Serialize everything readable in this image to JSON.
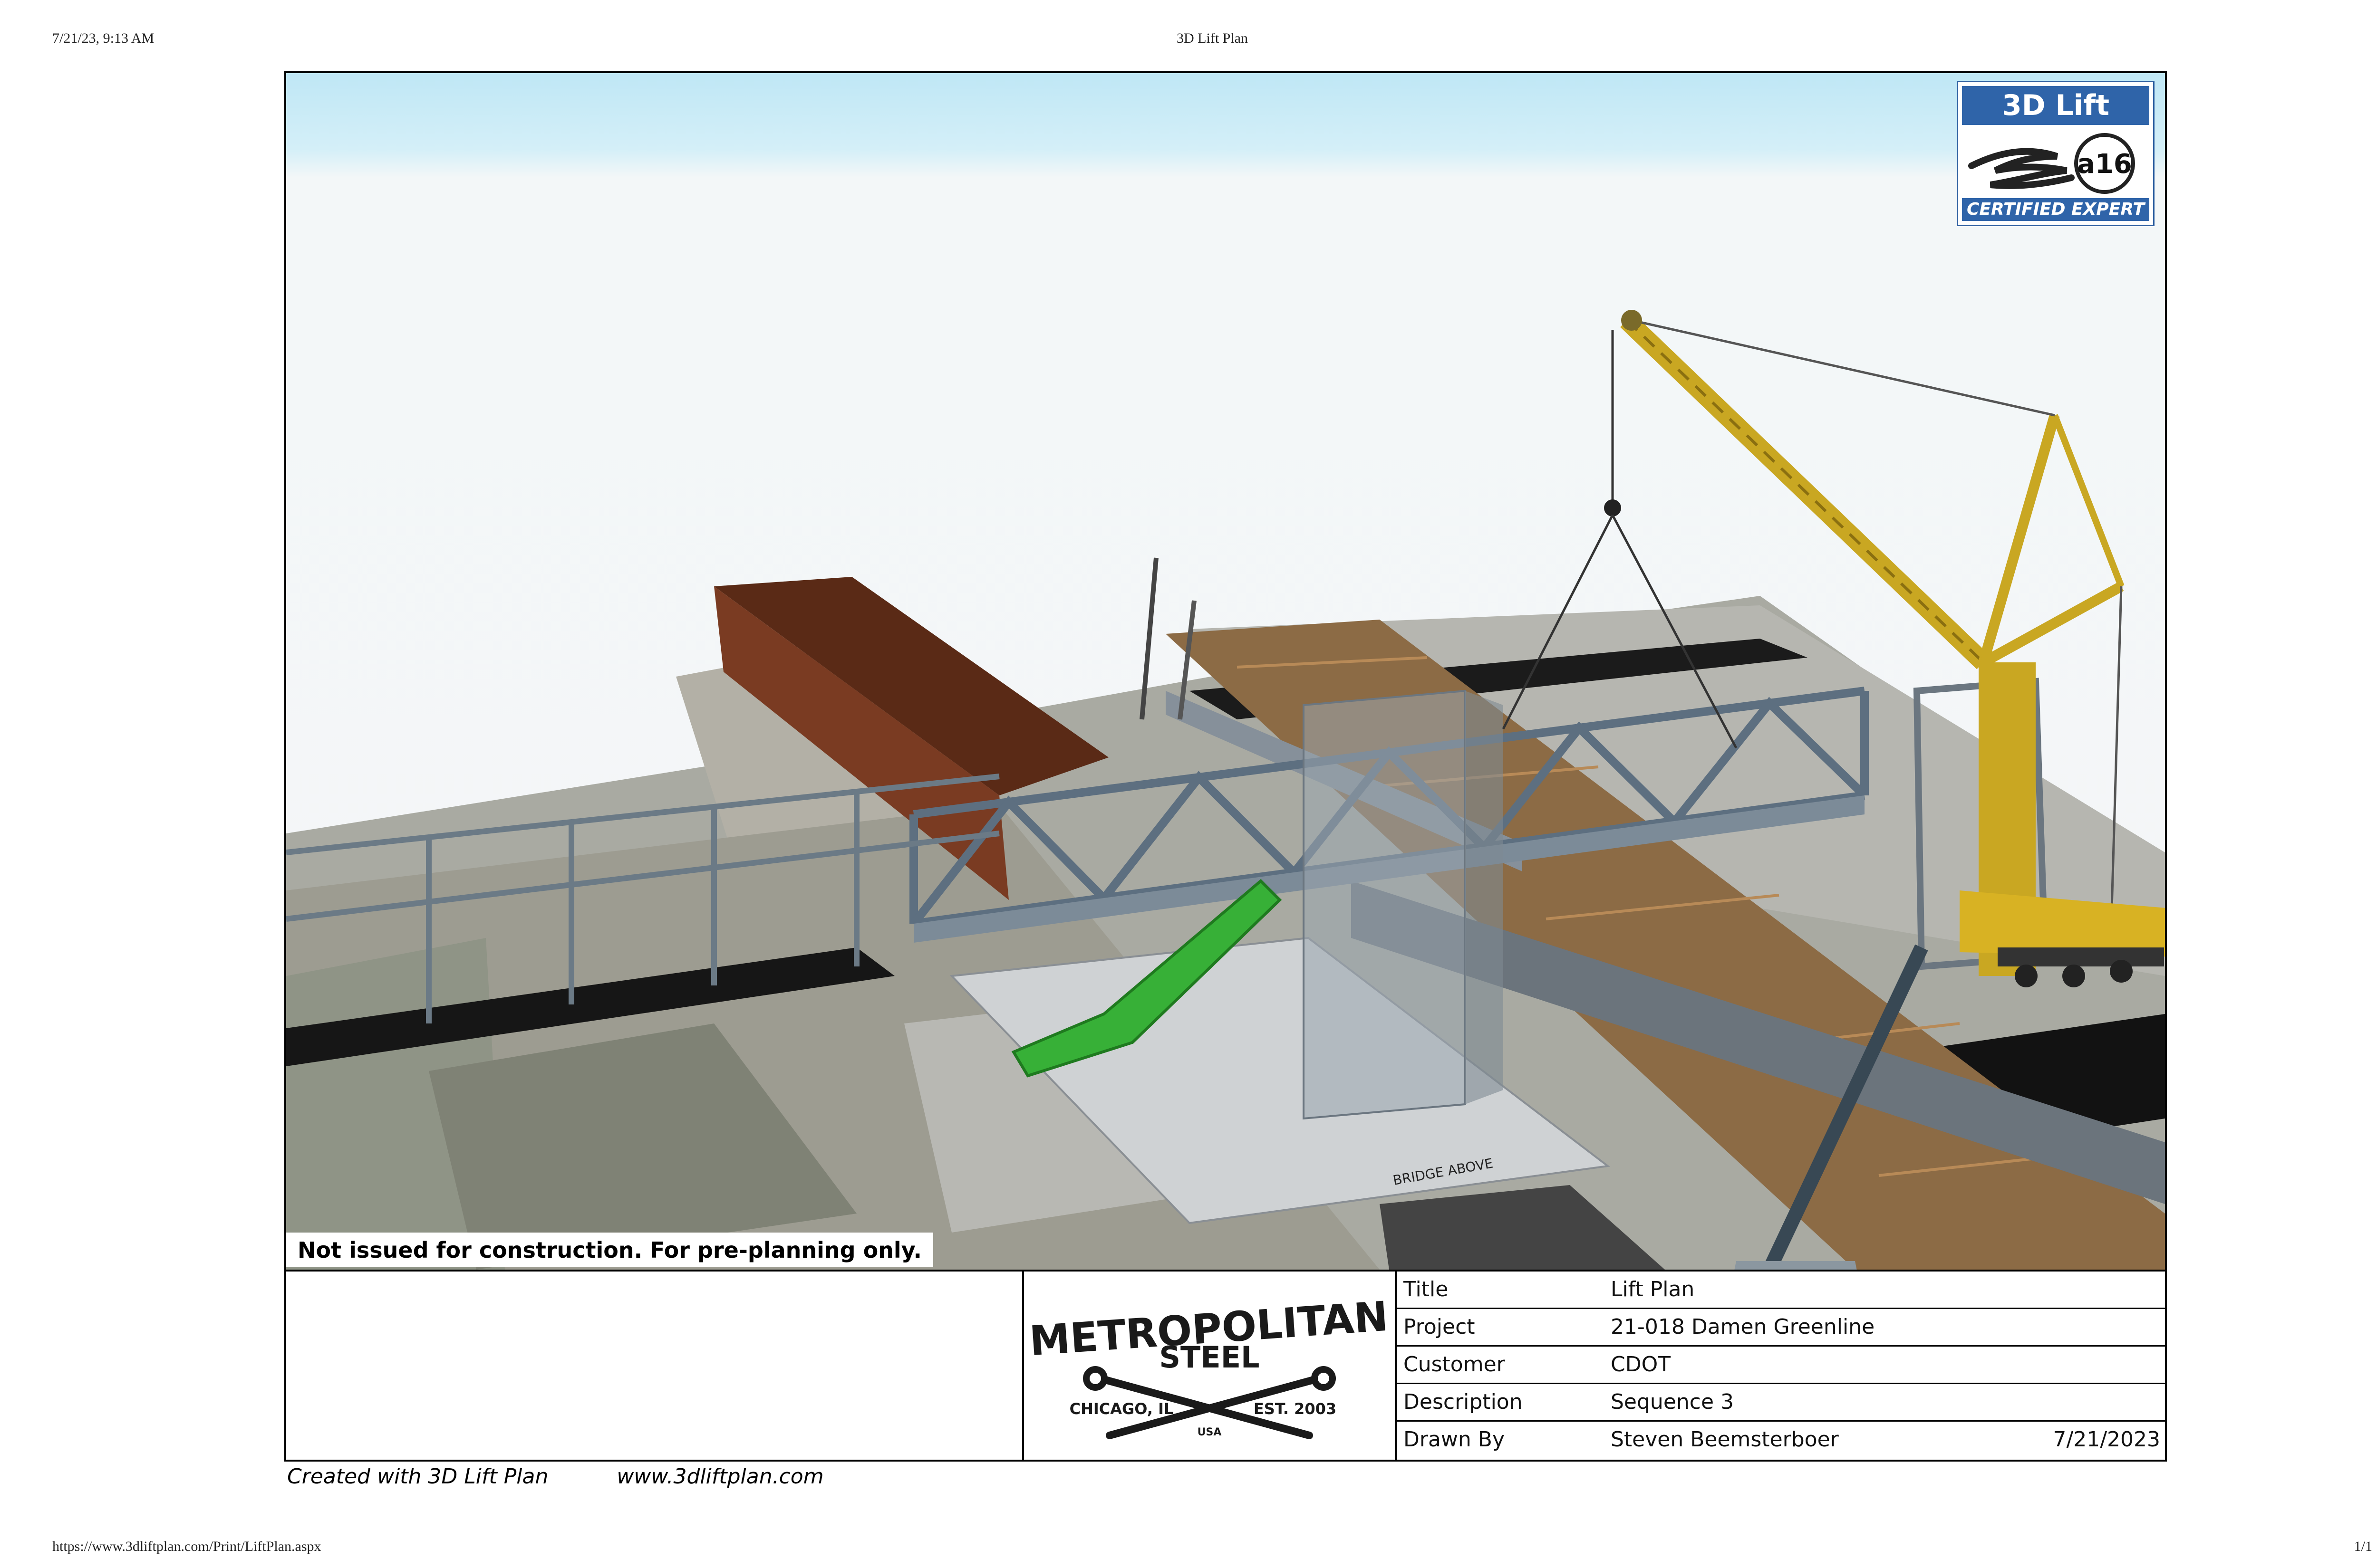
{
  "browser": {
    "datetime": "7/21/23, 9:13 AM",
    "page_title": "3D Lift Plan",
    "url": "https://www.3dliftplan.com/Print/LiftPlan.aspx",
    "page_count": "1/1"
  },
  "scene": {
    "disclaimer": "Not issued for construction. For pre-planning only.",
    "map_label": "BRIDGE ABOVE"
  },
  "badge": {
    "title": "3D Lift Plan",
    "number": "a16",
    "caption": "CERTIFIED EXPERT",
    "color": "#2f64a9"
  },
  "logo": {
    "line1": "METROPOLITAN",
    "line2": "STEEL",
    "city": "CHICAGO, IL",
    "est": "EST. 2003",
    "country": "USA"
  },
  "title_block": {
    "rows": [
      {
        "label": "Title",
        "value": "Lift Plan"
      },
      {
        "label": "Project",
        "value": "21-018 Damen Greenline"
      },
      {
        "label": "Customer",
        "value": "CDOT"
      },
      {
        "label": "Description",
        "value": "Sequence 3"
      },
      {
        "label": "Drawn By",
        "value": "Steven Beemsterboer",
        "date": "7/21/2023"
      }
    ]
  },
  "footer": {
    "created_with": "Created with 3D Lift Plan",
    "website": "www.3dliftplan.com"
  }
}
